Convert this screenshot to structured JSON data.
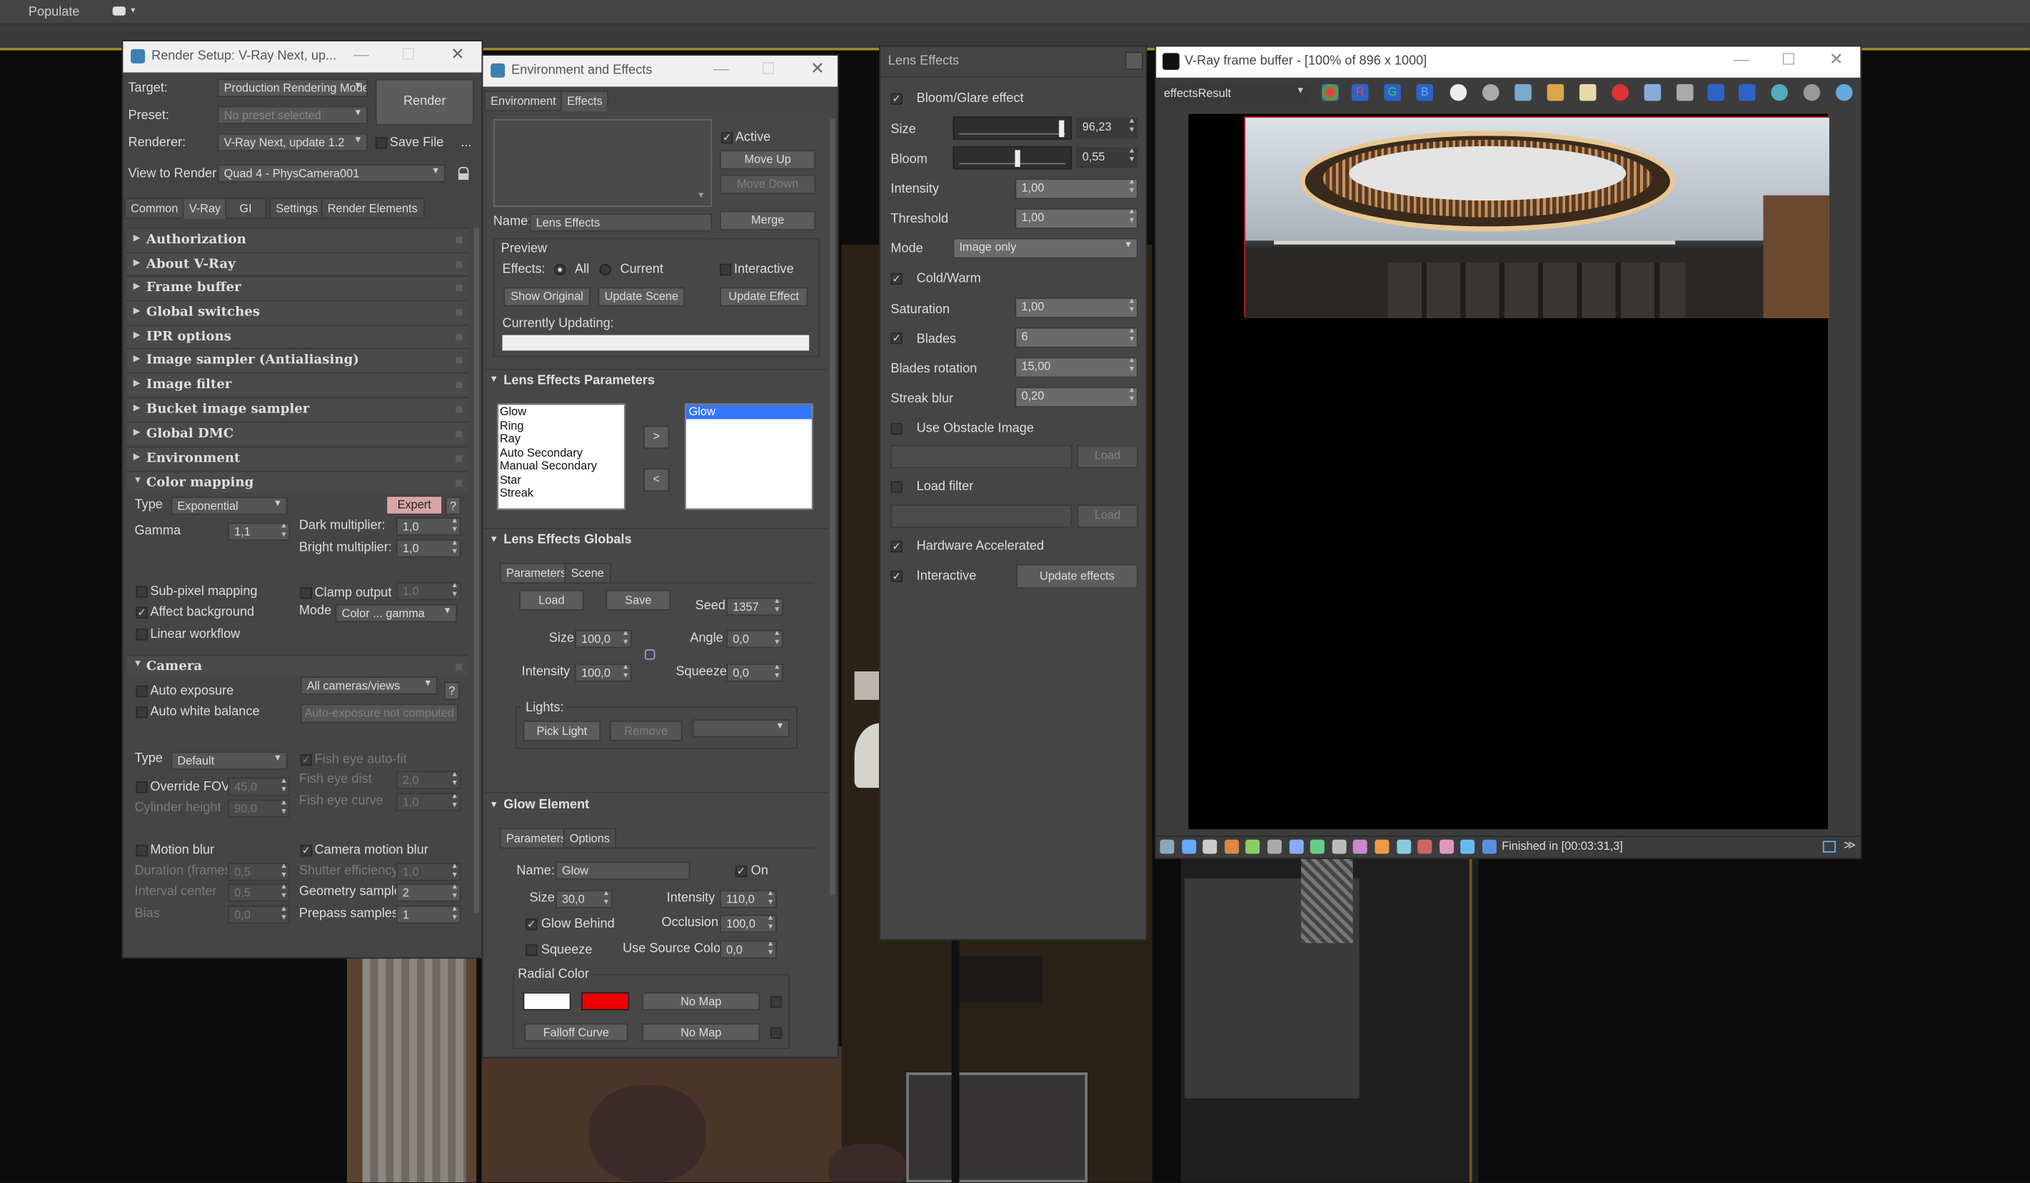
{
  "app": {
    "populate": "Populate"
  },
  "render_setup": {
    "title": "Render Setup: V-Ray Next, up...",
    "target_label": "Target:",
    "target": "Production Rendering Mode",
    "preset_label": "Preset:",
    "preset": "No preset selected",
    "renderer_label": "Renderer:",
    "renderer": "V-Ray Next, update 1.2",
    "save_file": "Save File",
    "view_label": "View to Render:",
    "view": "Quad 4 - PhysCamera001",
    "render_button": "Render",
    "more": "...",
    "tabs": [
      "Common",
      "V-Ray",
      "GI",
      "Settings",
      "Render Elements"
    ],
    "rollouts": [
      "Authorization",
      "About V-Ray",
      "Frame buffer",
      "Global switches",
      "IPR options",
      "Image sampler (Antialiasing)",
      "Image filter",
      "Bucket image sampler",
      "Global DMC",
      "Environment",
      "Color mapping"
    ],
    "color_mapping": {
      "type_label": "Type",
      "type": "Exponential",
      "expert": "Expert",
      "help": "?",
      "gamma_label": "Gamma",
      "gamma": "1,1",
      "dark_label": "Dark multiplier:",
      "dark": "1,0",
      "bright_label": "Bright multiplier:",
      "bright": "1,0",
      "subpixel": "Sub-pixel mapping",
      "clamp": "Clamp output",
      "clamp_val": "1,0",
      "affect_bg": "Affect background",
      "mode_label": "Mode",
      "mode": "Color ... gamma",
      "linear": "Linear workflow"
    },
    "camera": {
      "title": "Camera",
      "auto_exposure": "Auto exposure",
      "cameras": "All cameras/views",
      "help": "?",
      "auto_wb": "Auto white balance",
      "auto_exp_btn": "Auto-exposure not computed",
      "type_label": "Type",
      "type": "Default",
      "fisheye_fit": "Fish eye auto-fit",
      "override_fov": "Override FOV",
      "fov": "45,0",
      "fisheye_dist_label": "Fish eye dist",
      "fisheye_dist": "2,0",
      "cyl_label": "Cylinder height",
      "cyl": "90,0",
      "fisheye_curve_label": "Fish eye curve",
      "fisheye_curve": "1,0",
      "motion_blur": "Motion blur",
      "cam_motion_blur": "Camera motion blur",
      "duration_label": "Duration (frames)",
      "duration": "0,5",
      "shutter_label": "Shutter efficiency",
      "shutter": "1,0",
      "interval_label": "Interval center",
      "interval": "0,5",
      "geom_label": "Geometry samples",
      "geom": "2",
      "bias_label": "Bias",
      "bias": "0,0",
      "prepass_label": "Prepass samples",
      "prepass": "1"
    }
  },
  "env_effects": {
    "title": "Environment and Effects",
    "tabs": [
      "Environment",
      "Effects"
    ],
    "active": "Active",
    "move_up": "Move Up",
    "move_down": "Move Down",
    "name_label": "Name:",
    "name": "Lens Effects",
    "merge": "Merge",
    "preview": "Preview",
    "effects_label": "Effects:",
    "all": "All",
    "current": "Current",
    "interactive": "Interactive",
    "show_original": "Show Original",
    "update_scene": "Update Scene",
    "update_effect": "Update Effect",
    "currently_updating": "Currently Updating:",
    "lep_title": "Lens Effects Parameters",
    "lens_list": [
      "Glow",
      "Ring",
      "Ray",
      "Auto Secondary",
      "Manual Secondary",
      "Star",
      "Streak"
    ],
    "selected": [
      "Glow"
    ],
    "add": ">",
    "remove": "<",
    "leg_title": "Lens Effects Globals",
    "leg_tabs": [
      "Parameters",
      "Scene"
    ],
    "load": "Load",
    "save": "Save",
    "seed_label": "Seed",
    "seed": "1357",
    "size_label": "Size",
    "size": "100,0",
    "angle_label": "Angle",
    "angle": "0,0",
    "intensity_label": "Intensity",
    "intensity": "100,0",
    "squeeze_label": "Squeeze",
    "squeeze": "0,0",
    "lights_label": "Lights:",
    "pick_light": "Pick Light",
    "remove_btn": "Remove",
    "glow_title": "Glow Element",
    "glow_tabs": [
      "Parameters",
      "Options"
    ],
    "glow_name_label": "Name:",
    "glow_name": "Glow",
    "on": "On",
    "g_size_label": "Size",
    "g_size": "30,0",
    "g_intensity_label": "Intensity",
    "g_intensity": "110,0",
    "glow_behind": "Glow Behind",
    "occlusion_label": "Occlusion",
    "occlusion": "100,0",
    "g_squeeze": "Squeeze",
    "use_source_label": "Use Source Color",
    "use_source": "0,0",
    "radial_color": "Radial Color",
    "no_map": "No Map",
    "falloff": "Falloff Curve",
    "color_white": "#ffffff",
    "color_red": "#ee0000"
  },
  "lens_effects": {
    "title": "Lens Effects",
    "bloom_glare": "Bloom/Glare effect",
    "size_label": "Size",
    "size": "96,23",
    "size_level": 0.96,
    "bloom_label": "Bloom",
    "bloom": "0,55",
    "bloom_level": 0.55,
    "intensity_label": "Intensity",
    "intensity": "1,00",
    "threshold_label": "Threshold",
    "threshold": "1,00",
    "mode_label": "Mode",
    "mode": "Image only",
    "cold_warm": "Cold/Warm",
    "saturation_label": "Saturation",
    "saturation": "1,00",
    "blades_label": "Blades",
    "blades": "6",
    "blades_rot_label": "Blades rotation",
    "blades_rot": "15,00",
    "streak_label": "Streak blur",
    "streak": "0,20",
    "obstacle": "Use Obstacle Image",
    "load": "Load",
    "load_filter": "Load filter",
    "hw": "Hardware Accelerated",
    "interactive": "Interactive",
    "update": "Update effects"
  },
  "vfb": {
    "title": "V-Ray frame buffer - [100% of 896 x 1000]",
    "channel": "effectsResult",
    "r": "R",
    "g": "G",
    "b": "B",
    "status": "Finished in [00:03:31,3]"
  }
}
